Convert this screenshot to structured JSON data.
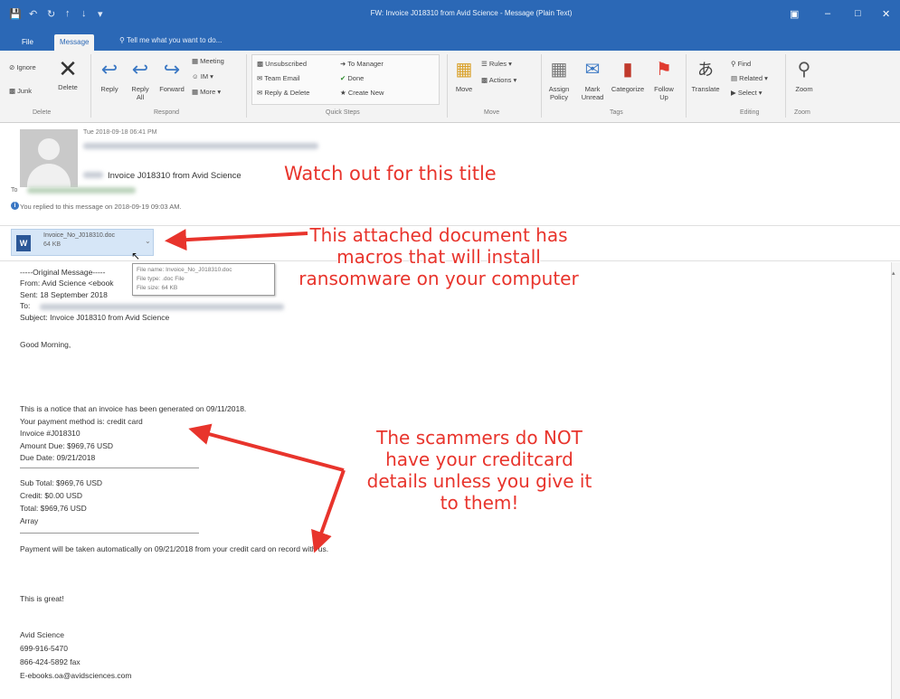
{
  "window": {
    "title": "FW: Invoice J018310 from Avid Science - Message (Plain Text)"
  },
  "tabs": [
    {
      "label": "File"
    },
    {
      "label": "Message"
    }
  ],
  "tell_me": "Tell me what you want to do...",
  "ribbon": {
    "delete_group": {
      "ignore": "Ignore",
      "junk": "Junk",
      "delete": "Delete",
      "label": "Delete"
    },
    "respond_group": {
      "reply": "Reply",
      "reply_all": "Reply All",
      "forward": "Forward",
      "meeting": "Meeting",
      "im": "IM",
      "more": "More",
      "label": "Respond"
    },
    "quick_steps": {
      "items": [
        "Unsubscribed",
        "Team Email",
        "Reply & Delete",
        "To Manager",
        "Done",
        "Create New"
      ],
      "label": "Quick Steps"
    },
    "move_group": {
      "move": "Move",
      "rules": "Rules",
      "actions": "Actions",
      "label": "Move"
    },
    "tags_group": {
      "assign_policy": "Assign Policy",
      "mark_unread": "Mark Unread",
      "categorize": "Categorize",
      "follow_up": "Follow Up",
      "label": "Tags"
    },
    "editing_group": {
      "translate": "Translate",
      "find": "Find",
      "related": "Related",
      "select": "Select",
      "label": "Editing"
    },
    "zoom_group": {
      "zoom": "Zoom",
      "label": "Zoom"
    }
  },
  "message": {
    "date": "Tue 2018-09-18 06:41 PM",
    "subject": "Invoice J018310 from Avid Science",
    "to_label": "To",
    "replied_notice": "You replied to this message on 2018-09-19 09:03 AM."
  },
  "attachment": {
    "name": "Invoice_No_J018310.doc",
    "size": "64 KB",
    "tooltip": {
      "name": "File name: Invoice_No_J018310.doc",
      "type": "File type: .doc File",
      "size": "File size: 64 KB"
    }
  },
  "body_lines": {
    "orig": "-----Original Message-----",
    "from": "From: Avid Science <ebook",
    "sent": "Sent: 18 September 2018",
    "to": "To:",
    "subject": "Subject: Invoice J018310 from Avid Science",
    "greeting": "Good Morning,",
    "notice": "This is a notice that an invoice has been generated on 09/11/2018.",
    "payment_method": "Your payment method is: credit card",
    "invoice": "Invoice #J018310",
    "amount": "Amount Due: $969,76 USD",
    "due": "Due Date: 09/21/2018",
    "subtotal": "Sub Total: $969,76 USD",
    "credit": "Credit: $0.00 USD",
    "total": "Total: $969,76 USD",
    "array": "Array",
    "payment_note": "Payment will be taken automatically on 09/21/2018 from your credit card on record with us.",
    "great": "This is great!",
    "sig_name": "Avid Science",
    "sig_phone": "699-916-5470",
    "sig_fax": "866-424-5892 fax",
    "sig_email": "E-ebooks.oa@avidsciences.com"
  },
  "annotations": {
    "title_warning": "Watch out for this title",
    "attachment_warning": [
      "This attached document has",
      "macros that will install",
      "ransomware on your computer"
    ],
    "card_warning": [
      "The scammers do NOT",
      "have your creditcard",
      "details unless you give it",
      "to them!"
    ],
    "color": "#e8342c"
  }
}
